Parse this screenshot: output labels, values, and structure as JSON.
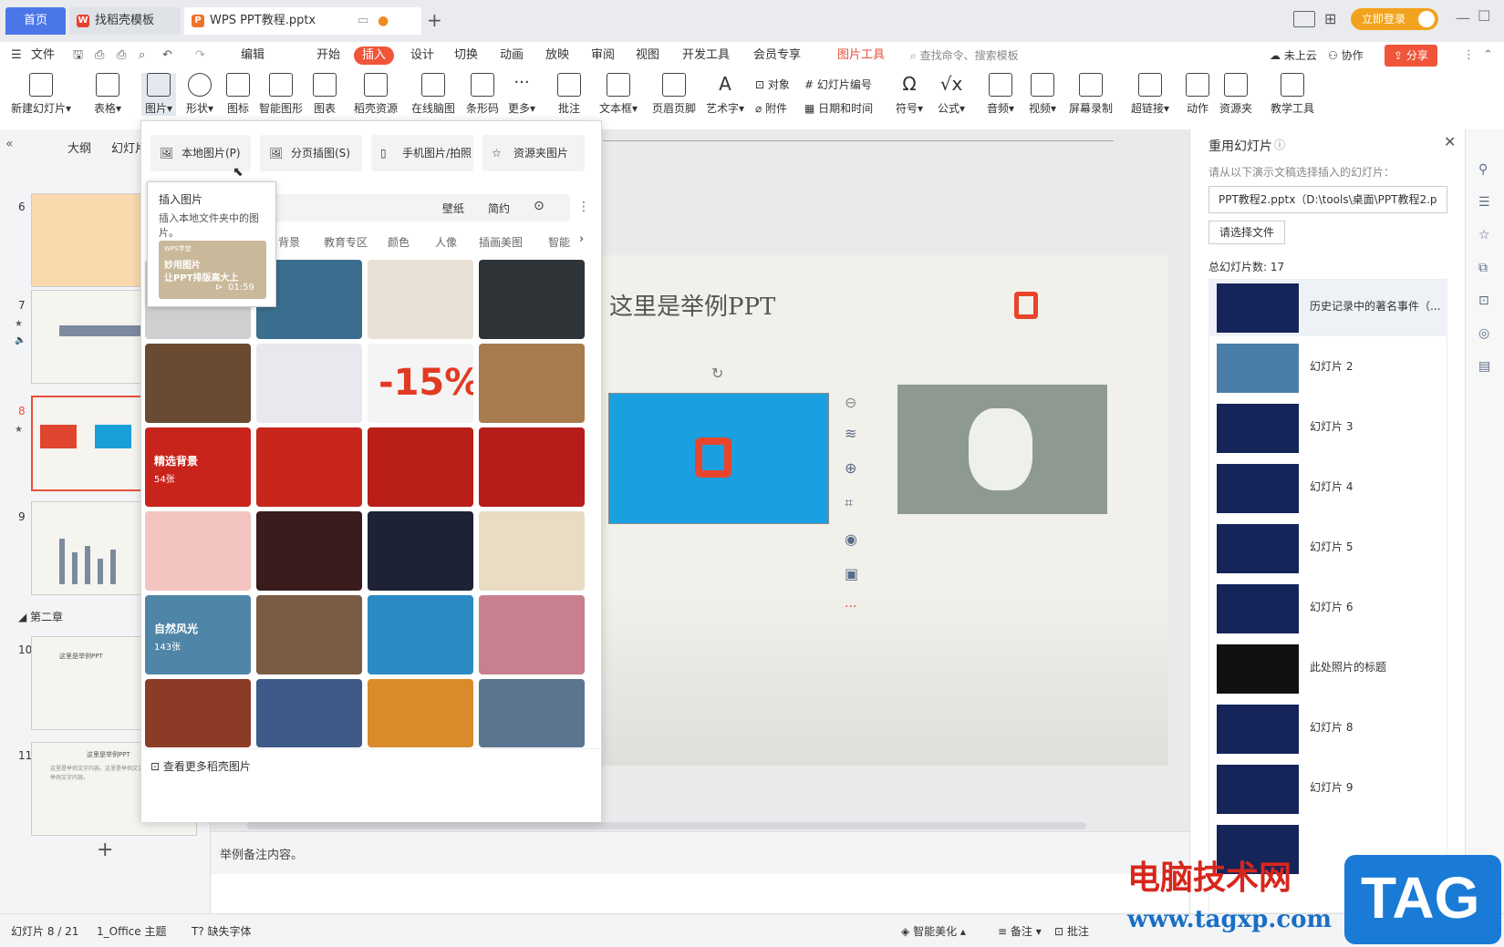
{
  "titlebar": {
    "tabs": [
      "首页",
      "找稻壳模板",
      "WPS PPT教程.pptx"
    ],
    "login": "立即登录"
  },
  "menubar": {
    "file": "文件",
    "edit": "编辑",
    "items": [
      "开始",
      "插入",
      "设计",
      "切换",
      "动画",
      "放映",
      "审阅",
      "视图",
      "开发工具",
      "会员专享"
    ],
    "picture_tools": "图片工具",
    "search_placeholder": "查找命令、搜索模板",
    "cloud": "未上云",
    "collab": "协作",
    "share": "分享"
  },
  "ribbon": {
    "new_slide": "新建幻灯片",
    "table": "表格",
    "picture": "图片",
    "shape": "形状",
    "icon": "图标",
    "smart": "智能图形",
    "chart": "图表",
    "docer": "稻壳资源",
    "mindmap": "在线脑图",
    "barcode": "条形码",
    "more": "更多",
    "comment": "批注",
    "textbox": "文本框",
    "header": "页眉页脚",
    "wordart": "艺术字",
    "object": "对象",
    "attach": "附件",
    "slide_num": "幻灯片编号",
    "datetime": "日期和时间",
    "symbol": "符号",
    "formula": "公式",
    "audio": "音频",
    "video": "视频",
    "screenrec": "屏幕录制",
    "hyperlink": "超链接",
    "action": "动作",
    "resource": "资源夹",
    "teach": "教学工具"
  },
  "leftpanel": {
    "outline": "大纲",
    "slides": "幻灯片",
    "chapter": "第二章",
    "numbers": [
      "6",
      "7",
      "8",
      "9",
      "10",
      "11"
    ],
    "thumb_title": "这里是举例PPT",
    "thumb_text": "这里是举例文字内容。这里是举例文字内容。这里是举例文字内容。"
  },
  "popup": {
    "local": "本地图片(P)",
    "paged": "分页插图(S)",
    "phone": "手机图片/拍照",
    "resource": "资源夹图片",
    "tooltip_title": "插入图片",
    "tooltip_desc": "插入本地文件夹中的图片。",
    "video_line1": "妙用图片",
    "video_line2": "让PPT排版高大上",
    "video_time": "01:59",
    "video_brand": "WPS学堂",
    "search_tags": [
      "壁纸",
      "简约"
    ],
    "categories": [
      "背景",
      "教育专区",
      "颜色",
      "人像",
      "插画美图",
      "智能"
    ],
    "featured_bg": "精选背景",
    "featured_bg_count": "54张",
    "nature": "自然风光",
    "nature_count": "143张",
    "more": "查看更多稻壳图片"
  },
  "slide": {
    "title": "这里是举例PPT",
    "notes": "举例备注内容。"
  },
  "rightpanel": {
    "title": "重用幻灯片",
    "subtitle": "请从以下演示文稿选择插入的幻灯片：",
    "file": "PPT教程2.pptx（D:\\tools\\桌面\\PPT教程2.p",
    "choose": "请选择文件",
    "total": "总幻灯片数: 17",
    "items": [
      "历史记录中的著名事件（...",
      "幻灯片 2",
      "幻灯片 3",
      "幻灯片 4",
      "幻灯片 5",
      "幻灯片 6",
      "此处照片的标题",
      "幻灯片 8",
      "幻灯片 9"
    ]
  },
  "statusbar": {
    "slide_count": "幻灯片 8 / 21",
    "theme": "1_Office 主题",
    "font": "缺失字体",
    "beautify": "智能美化",
    "notes": "备注",
    "comment": "批注"
  },
  "watermark": {
    "cn": "电脑技术网",
    "url": "www.tagxp.com",
    "tag": "TAG"
  }
}
